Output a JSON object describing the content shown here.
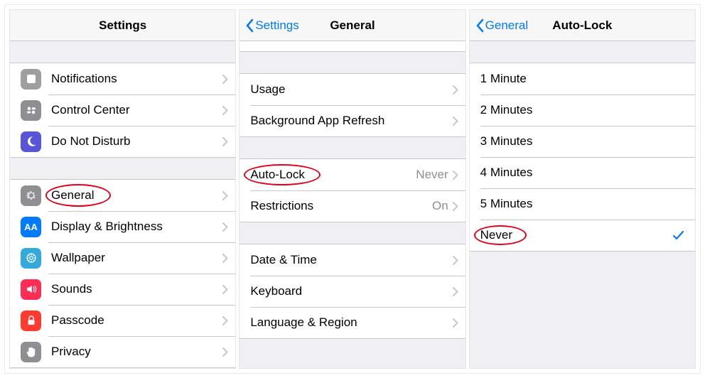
{
  "panel1": {
    "title": "Settings",
    "groups": [
      [
        {
          "icon": "notifications",
          "label": "Notifications"
        },
        {
          "icon": "control-center",
          "label": "Control Center"
        },
        {
          "icon": "dnd",
          "label": "Do Not Disturb"
        }
      ],
      [
        {
          "icon": "general",
          "label": "General",
          "highlighted": true
        },
        {
          "icon": "display",
          "label": "Display & Brightness"
        },
        {
          "icon": "wallpaper",
          "label": "Wallpaper"
        },
        {
          "icon": "sounds",
          "label": "Sounds"
        },
        {
          "icon": "passcode",
          "label": "Passcode"
        },
        {
          "icon": "privacy",
          "label": "Privacy"
        }
      ]
    ]
  },
  "panel2": {
    "back": "Settings",
    "title": "General",
    "groups": [
      [
        {
          "label": "Usage"
        },
        {
          "label": "Background App Refresh"
        }
      ],
      [
        {
          "label": "Auto-Lock",
          "value": "Never",
          "highlighted": true
        },
        {
          "label": "Restrictions",
          "value": "On"
        }
      ],
      [
        {
          "label": "Date & Time"
        },
        {
          "label": "Keyboard"
        },
        {
          "label": "Language & Region"
        }
      ]
    ]
  },
  "panel3": {
    "back": "General",
    "title": "Auto-Lock",
    "options": [
      {
        "label": "1 Minute",
        "selected": false
      },
      {
        "label": "2 Minutes",
        "selected": false
      },
      {
        "label": "3 Minutes",
        "selected": false
      },
      {
        "label": "4 Minutes",
        "selected": false
      },
      {
        "label": "5 Minutes",
        "selected": false
      },
      {
        "label": "Never",
        "selected": true,
        "highlighted": true
      }
    ]
  }
}
